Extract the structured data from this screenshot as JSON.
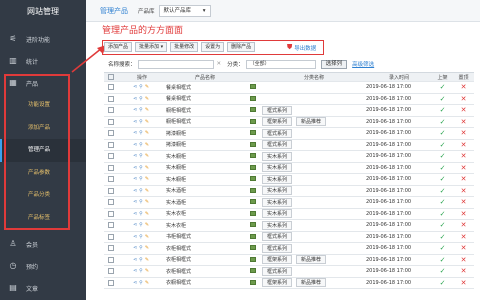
{
  "sidebar": {
    "brand": "网站管理",
    "items": [
      {
        "label": "进阶功能",
        "icon": "sliders-icon"
      },
      {
        "label": "统计",
        "icon": "chart-icon"
      },
      {
        "label": "产品",
        "icon": "grid-icon"
      }
    ],
    "sub_items": [
      "功能设置",
      "添加产品",
      "管理产品",
      "产品参数",
      "产品分类",
      "产品标签"
    ],
    "active_sub": "管理产品",
    "bottom_items": [
      {
        "label": "会员",
        "icon": "member-icon"
      },
      {
        "label": "预约",
        "icon": "clock-icon"
      },
      {
        "label": "文章",
        "icon": "doc-icon"
      }
    ]
  },
  "header": {
    "title": "管理产品",
    "library_label": "产品库",
    "library_value": "默认产品库"
  },
  "annotation": "管理产品的方方面面",
  "toolbar": {
    "buttons": [
      "添加产品",
      "批量添加 ▾",
      "批量修改",
      "设置为",
      "删除产品"
    ],
    "export_label": "导出数据"
  },
  "filter": {
    "name_label": "名称搜索：",
    "category_label": "分类：",
    "category_value": "（全部）",
    "select_button": "选择列",
    "advanced": "高级筛选"
  },
  "table": {
    "headers": [
      "操作",
      "产品名称",
      "分类名称",
      "录入时间",
      "上架",
      "置顶"
    ],
    "rows": [
      {
        "name": "餐桌相框式",
        "cats": [],
        "date": "2019-06-18 17:00",
        "up": true,
        "top": false
      },
      {
        "name": "餐桌相框式",
        "cats": [],
        "date": "2019-06-18 17:00",
        "up": true,
        "top": false
      },
      {
        "name": "橱柜相框式",
        "cats": [
          "框式系列"
        ],
        "date": "2019-06-18 17:00",
        "up": true,
        "top": false
      },
      {
        "name": "橱柜相框式",
        "cats": [
          "框架系列",
          "新品推荐"
        ],
        "date": "2019-06-18 17:00",
        "up": true,
        "top": false
      },
      {
        "name": "拷漆橱柜",
        "cats": [
          "框式系列"
        ],
        "date": "2019-06-18 17:00",
        "up": true,
        "top": false
      },
      {
        "name": "拷漆橱柜",
        "cats": [
          "框式系列"
        ],
        "date": "2019-06-18 17:00",
        "up": true,
        "top": false
      },
      {
        "name": "实木橱柜",
        "cats": [
          "实木系列"
        ],
        "date": "2019-06-18 17:00",
        "up": true,
        "top": false
      },
      {
        "name": "实木橱柜",
        "cats": [
          "实木系列"
        ],
        "date": "2019-06-18 17:00",
        "up": true,
        "top": false
      },
      {
        "name": "实木橱柜",
        "cats": [
          "实木系列"
        ],
        "date": "2019-06-18 17:00",
        "up": true,
        "top": false
      },
      {
        "name": "实木酒柜",
        "cats": [
          "实木系列"
        ],
        "date": "2019-06-18 17:00",
        "up": true,
        "top": false
      },
      {
        "name": "实木酒柜",
        "cats": [
          "实木系列"
        ],
        "date": "2019-06-18 17:00",
        "up": true,
        "top": false
      },
      {
        "name": "实木衣柜",
        "cats": [
          "实木系列"
        ],
        "date": "2019-06-18 17:00",
        "up": true,
        "top": false
      },
      {
        "name": "实木衣柜",
        "cats": [
          "实木系列"
        ],
        "date": "2019-06-18 17:00",
        "up": true,
        "top": false
      },
      {
        "name": "书柜相框式",
        "cats": [
          "框式系列"
        ],
        "date": "2019-06-18 17:00",
        "up": true,
        "top": false
      },
      {
        "name": "衣柜相框式",
        "cats": [
          "框式系列"
        ],
        "date": "2019-06-18 17:00",
        "up": true,
        "top": false
      },
      {
        "name": "衣柜相框式",
        "cats": [
          "框架系列",
          "新品推荐"
        ],
        "date": "2019-06-18 17:00",
        "up": true,
        "top": false
      },
      {
        "name": "衣柜相框式",
        "cats": [
          "框式系列"
        ],
        "date": "2019-06-18 17:00",
        "up": true,
        "top": false
      },
      {
        "name": "衣橱相框式",
        "cats": [
          "框架系列",
          "新品推荐"
        ],
        "date": "2019-06-18 17:00",
        "up": true,
        "top": false
      }
    ]
  },
  "colors": {
    "sidebar_bg": "#323a45",
    "accent": "#2f80d1",
    "annotation": "#e03a3a",
    "check": "#2aa44f"
  }
}
